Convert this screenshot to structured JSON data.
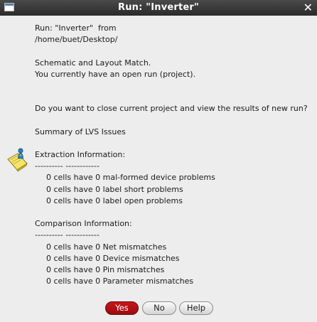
{
  "window": {
    "title": "Run: \"Inverter\"",
    "close_glyph": "✕"
  },
  "message": {
    "run_line": "Run: \"Inverter\"  from",
    "path_line": "/home/buet/Desktop/",
    "match_line": "Schematic and Layout Match.",
    "open_run_line": "You currently have an open run (project).",
    "question_line": "Do you want to close current project and view the results of new run?",
    "summary_title": "Summary of LVS Issues",
    "extraction_title": "Extraction Information:",
    "extraction_underline": "---------- ------------",
    "extraction_items": [
      "0 cells have 0 mal-formed device problems",
      "0 cells have 0 label short problems",
      "0 cells have 0 label open problems"
    ],
    "comparison_title": "Comparison Information:",
    "comparison_underline": "---------- ------------",
    "comparison_items": [
      "0 cells have 0 Net mismatches",
      "0 cells have 0 Device mismatches",
      "0 cells have 0 Pin mismatches",
      "0 cells have 0 Parameter mismatches"
    ]
  },
  "icons": {
    "window_icon": "window-icon",
    "info": "info-note-icon"
  },
  "buttons": {
    "yes": "Yes",
    "no": "No",
    "help": "Help"
  },
  "colors": {
    "titlebar": "#2f2f2f",
    "background": "#ededed",
    "yes_button": "#b51216",
    "text": "#1a1a1a"
  }
}
